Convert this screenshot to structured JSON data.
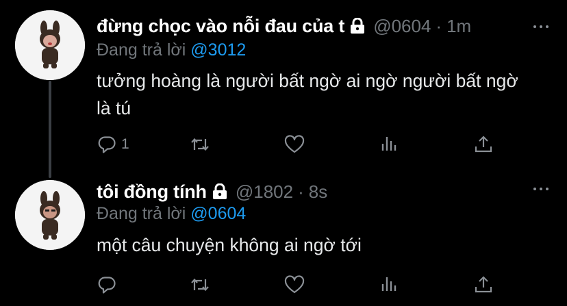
{
  "tweets": [
    {
      "display_name": "đừng chọc vào nỗi đau của t",
      "handle": "@0604",
      "separator": "·",
      "time": "1m",
      "replying_label": "Đang trả lời",
      "replying_to": "@3012",
      "text": "tưởng hoàng là người bất ngờ ai ngờ người bất ngờ là tú",
      "reply_count": "1",
      "protected": true
    },
    {
      "display_name": "tôi đồng tính",
      "handle": "@1802",
      "separator": "·",
      "time": "8s",
      "replying_label": "Đang trả lời",
      "replying_to": "@0604",
      "text": "một câu chuyện không ai ngờ tới",
      "reply_count": "",
      "protected": true
    }
  ],
  "icons": {
    "reply": "reply-icon",
    "retweet": "retweet-icon",
    "like": "heart-icon",
    "views": "views-icon",
    "share": "share-icon",
    "more": "more-icon",
    "lock": "lock-icon"
  },
  "colors": {
    "background": "#000000",
    "text": "#e7e9ea",
    "secondary": "#71767b",
    "link": "#1d9bf0",
    "thread_line": "#3b3f44"
  }
}
